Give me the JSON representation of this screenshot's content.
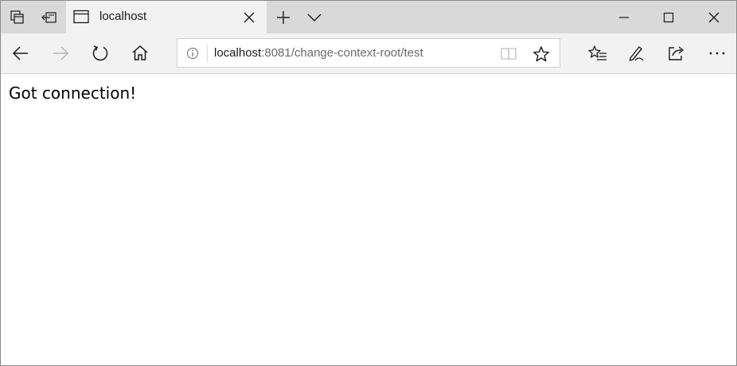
{
  "browser": {
    "tab": {
      "title": "localhost"
    },
    "address_bar": {
      "host": "localhost",
      "path": ":8081/change-context-root/test"
    }
  },
  "page": {
    "message": "Got connection!"
  },
  "icons": {
    "tab_actions": "tab-actions-icon",
    "set_aside": "set-aside-tabs-icon",
    "page_tab": "page-tab-icon",
    "close_tab": "close-icon",
    "new_tab": "plus-icon",
    "tab_preview": "chevron-down-icon",
    "minimize": "minimize-icon",
    "maximize": "maximize-icon",
    "close_window": "close-icon",
    "back": "back-arrow-icon",
    "forward": "forward-arrow-icon",
    "refresh": "refresh-icon",
    "home": "home-icon",
    "site_info": "info-icon",
    "reading_view": "book-icon",
    "favorite": "star-icon",
    "favorites_hub": "favorites-list-icon",
    "notes": "pen-icon",
    "share": "share-icon",
    "more": "more-icon"
  },
  "colors": {
    "tab_strip": "#d9d9d9",
    "toolbar": "#f2f2f2",
    "url_host": "#1a1a1a",
    "url_path": "#6b6b6b",
    "forward_disabled": "#b5b5b5"
  }
}
